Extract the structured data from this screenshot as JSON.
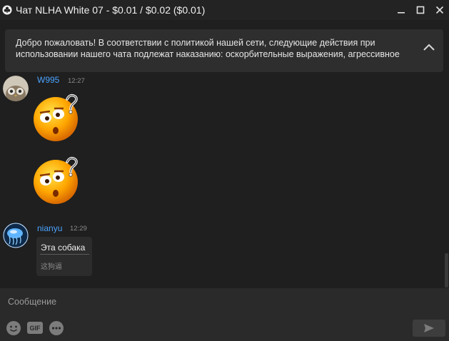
{
  "window": {
    "title": "Чат NLHA White 07 - $0.01 / $0.02 ($0.01)"
  },
  "banner": {
    "text": "Добро пожаловать! В соответствии с политикой нашей сети, следующие действия при использовании нашего чата подлежат наказанию: оскорбительные выражения, агрессивное"
  },
  "messages": [
    {
      "username": "W995",
      "time": "12:27",
      "content_type": "emoji",
      "emojis": [
        "confused-face-emoji",
        "confused-face-emoji"
      ]
    },
    {
      "username": "nianyu",
      "time": "12:29",
      "text": "Эта собака",
      "translation": "这狗逼"
    }
  ],
  "composer": {
    "placeholder": "Сообщение",
    "gif_label": "GIF"
  },
  "colors": {
    "background": "#1f1f1f",
    "username": "#4aa3ff",
    "banner": "#2e2e2e"
  }
}
